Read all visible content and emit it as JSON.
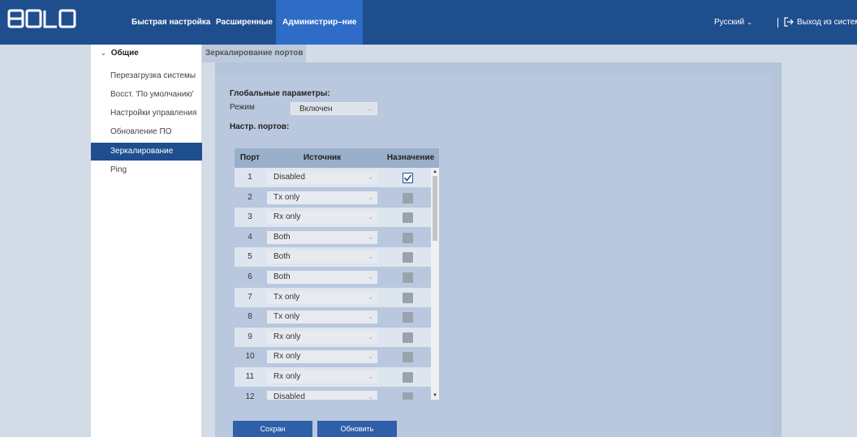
{
  "brand": {
    "logo_text": "BOLID"
  },
  "nav": {
    "items": [
      {
        "label": "Быстрая настройка"
      },
      {
        "label": "Расширенные"
      },
      {
        "label": "Администрир–ние"
      }
    ],
    "language": "Русский",
    "logout": "Выход из систем"
  },
  "sidebar": {
    "group": "Общие",
    "items": [
      {
        "label": "Перезагрузка системы"
      },
      {
        "label": "Восст. 'По умолчанию'"
      },
      {
        "label": "Настройки управления"
      },
      {
        "label": "Обновление ПО"
      },
      {
        "label": "Зеркалирование"
      },
      {
        "label": "Ping"
      }
    ]
  },
  "tab": "Зеркалирование портов",
  "global": {
    "title": "Глобальные параметры:",
    "mode_label": "Режим",
    "mode_value": "Включен"
  },
  "ports": {
    "title": "Настр. портов:",
    "headers": {
      "port": "Порт",
      "source": "Источник",
      "dest": "Назначение"
    },
    "rows": [
      {
        "port": "1",
        "source": "Disabled",
        "dest": true
      },
      {
        "port": "2",
        "source": "Tx only",
        "dest": false
      },
      {
        "port": "3",
        "source": "Rx only",
        "dest": false
      },
      {
        "port": "4",
        "source": "Both",
        "dest": false
      },
      {
        "port": "5",
        "source": "Both",
        "dest": false
      },
      {
        "port": "6",
        "source": "Both",
        "dest": false
      },
      {
        "port": "7",
        "source": "Tx only",
        "dest": false
      },
      {
        "port": "8",
        "source": "Tx only",
        "dest": false
      },
      {
        "port": "9",
        "source": "Rx only",
        "dest": false
      },
      {
        "port": "10",
        "source": "Rx only",
        "dest": false
      },
      {
        "port": "11",
        "source": "Rx only",
        "dest": false
      },
      {
        "port": "12",
        "source": "Disabled",
        "dest": false
      }
    ]
  },
  "buttons": {
    "save": "Сохран",
    "refresh": "Обновить"
  },
  "colors": {
    "topbar": "#1f4e8e",
    "active_nav": "#2f6cc8",
    "button": "#2f5fa8"
  }
}
